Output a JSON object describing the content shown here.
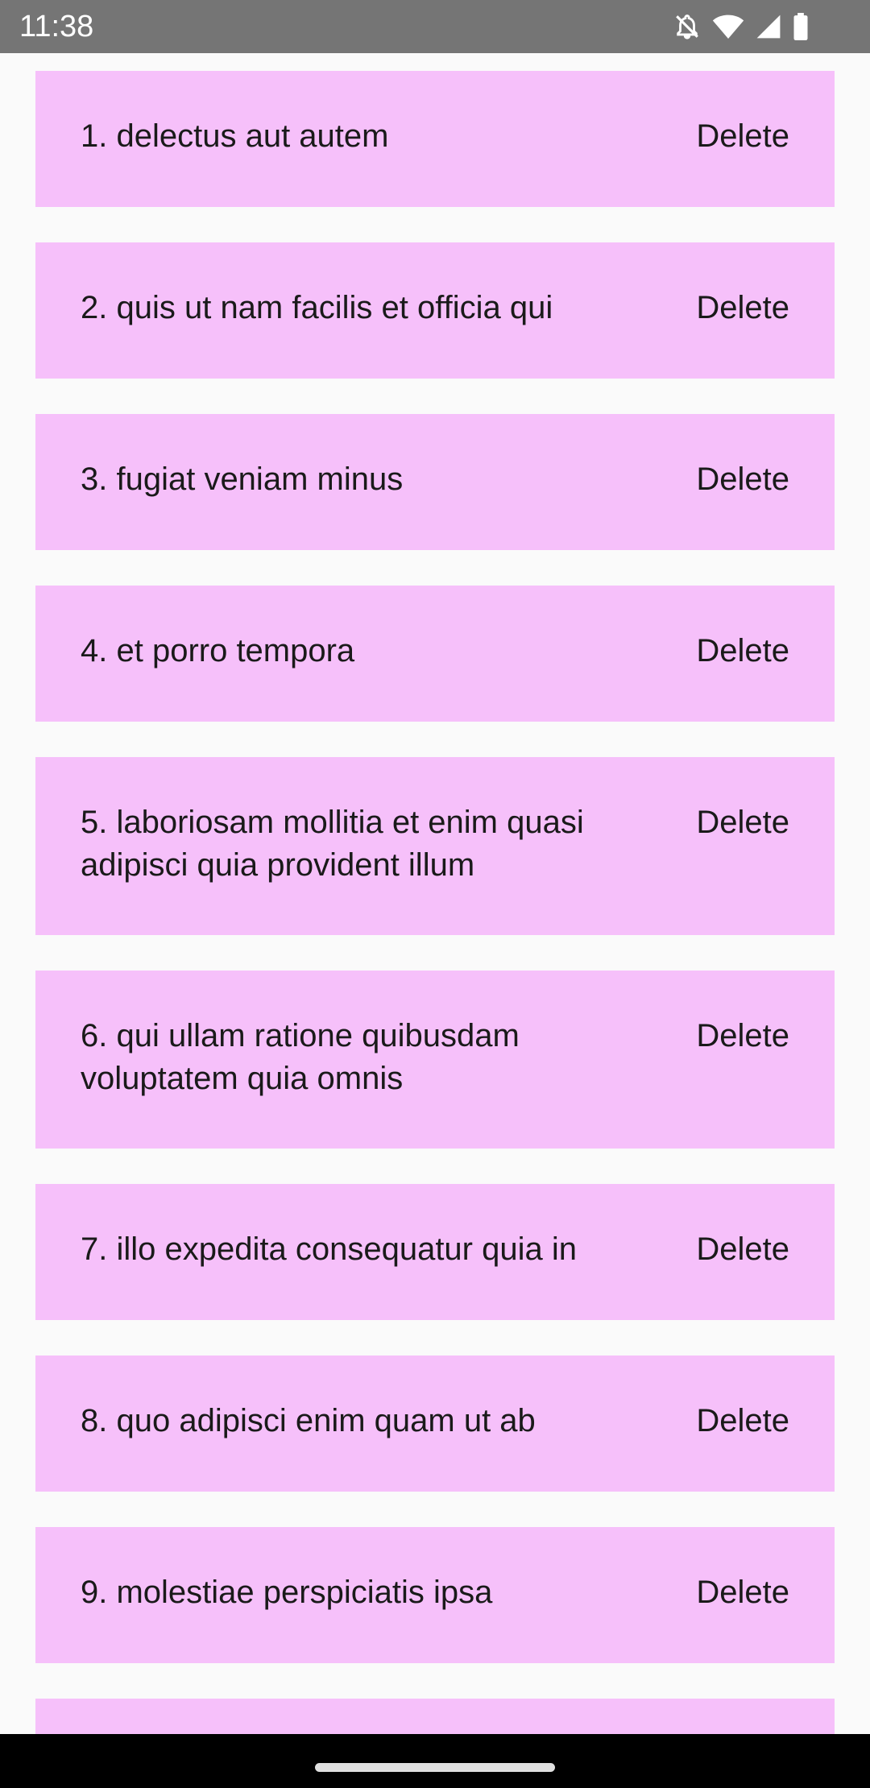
{
  "status_bar": {
    "time": "11:38",
    "icons": [
      "bell-off-icon",
      "wifi-icon",
      "signal-icon",
      "battery-icon"
    ]
  },
  "todos": {
    "items": [
      {
        "label": "1. delectus aut autem",
        "delete_label": "Delete"
      },
      {
        "label": "2. quis ut nam facilis et officia qui",
        "delete_label": "Delete"
      },
      {
        "label": "3. fugiat veniam minus",
        "delete_label": "Delete"
      },
      {
        "label": "4. et porro tempora",
        "delete_label": "Delete"
      },
      {
        "label": "5. laboriosam mollitia et enim quasi adipisci quia provident illum",
        "delete_label": "Delete"
      },
      {
        "label": "6. qui ullam ratione quibusdam voluptatem quia omnis",
        "delete_label": "Delete"
      },
      {
        "label": "7. illo expedita consequatur quia in",
        "delete_label": "Delete"
      },
      {
        "label": "8. quo adipisci enim quam ut ab",
        "delete_label": "Delete"
      },
      {
        "label": "9. molestiae perspiciatis ipsa",
        "delete_label": "Delete"
      },
      {
        "label": "",
        "delete_label": ""
      }
    ]
  },
  "colors": {
    "item_background": "#f6c0fa",
    "page_background": "#fafafa",
    "status_bar": "#757575",
    "nav_bar": "#000000"
  }
}
